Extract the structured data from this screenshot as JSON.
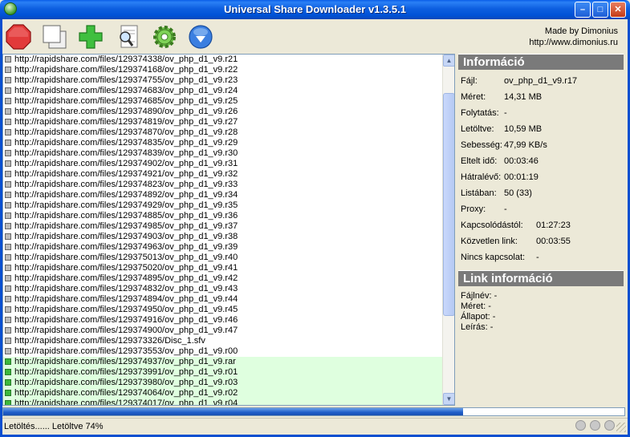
{
  "window": {
    "title": "Universal Share Downloader v1.3.5.1",
    "min_glyph": "–",
    "max_glyph": "□",
    "close_glyph": "✕"
  },
  "toolbar": {
    "icons": [
      "stop-icon",
      "copy-icon",
      "add-icon",
      "search-icon",
      "settings-icon",
      "info-icon"
    ],
    "madeby_line1": "Made by Dimonius",
    "madeby_line2": "http://www.dimonius.ru"
  },
  "list": {
    "rows": [
      {
        "url": "http://rapidshare.com/files/129374338/ov_php_d1_v9.r21",
        "done": false
      },
      {
        "url": "http://rapidshare.com/files/129374168/ov_php_d1_v9.r22",
        "done": false
      },
      {
        "url": "http://rapidshare.com/files/129374755/ov_php_d1_v9.r23",
        "done": false
      },
      {
        "url": "http://rapidshare.com/files/129374683/ov_php_d1_v9.r24",
        "done": false
      },
      {
        "url": "http://rapidshare.com/files/129374685/ov_php_d1_v9.r25",
        "done": false
      },
      {
        "url": "http://rapidshare.com/files/129374890/ov_php_d1_v9.r26",
        "done": false
      },
      {
        "url": "http://rapidshare.com/files/129374819/ov_php_d1_v9.r27",
        "done": false
      },
      {
        "url": "http://rapidshare.com/files/129374870/ov_php_d1_v9.r28",
        "done": false
      },
      {
        "url": "http://rapidshare.com/files/129374835/ov_php_d1_v9.r29",
        "done": false
      },
      {
        "url": "http://rapidshare.com/files/129374839/ov_php_d1_v9.r30",
        "done": false
      },
      {
        "url": "http://rapidshare.com/files/129374902/ov_php_d1_v9.r31",
        "done": false
      },
      {
        "url": "http://rapidshare.com/files/129374921/ov_php_d1_v9.r32",
        "done": false
      },
      {
        "url": "http://rapidshare.com/files/129374823/ov_php_d1_v9.r33",
        "done": false
      },
      {
        "url": "http://rapidshare.com/files/129374892/ov_php_d1_v9.r34",
        "done": false
      },
      {
        "url": "http://rapidshare.com/files/129374929/ov_php_d1_v9.r35",
        "done": false
      },
      {
        "url": "http://rapidshare.com/files/129374885/ov_php_d1_v9.r36",
        "done": false
      },
      {
        "url": "http://rapidshare.com/files/129374985/ov_php_d1_v9.r37",
        "done": false
      },
      {
        "url": "http://rapidshare.com/files/129374903/ov_php_d1_v9.r38",
        "done": false
      },
      {
        "url": "http://rapidshare.com/files/129374963/ov_php_d1_v9.r39",
        "done": false
      },
      {
        "url": "http://rapidshare.com/files/129375013/ov_php_d1_v9.r40",
        "done": false
      },
      {
        "url": "http://rapidshare.com/files/129375020/ov_php_d1_v9.r41",
        "done": false
      },
      {
        "url": "http://rapidshare.com/files/129374895/ov_php_d1_v9.r42",
        "done": false
      },
      {
        "url": "http://rapidshare.com/files/129374832/ov_php_d1_v9.r43",
        "done": false
      },
      {
        "url": "http://rapidshare.com/files/129374894/ov_php_d1_v9.r44",
        "done": false
      },
      {
        "url": "http://rapidshare.com/files/129374950/ov_php_d1_v9.r45",
        "done": false
      },
      {
        "url": "http://rapidshare.com/files/129374916/ov_php_d1_v9.r46",
        "done": false
      },
      {
        "url": "http://rapidshare.com/files/129374900/ov_php_d1_v9.r47",
        "done": false
      },
      {
        "url": "http://rapidshare.com/files/129373326/Disc_1.sfv",
        "done": false
      },
      {
        "url": "http://rapidshare.com/files/129373553/ov_php_d1_v9.r00",
        "done": false
      },
      {
        "url": "http://rapidshare.com/files/129374937/ov_php_d1_v9.rar",
        "done": true
      },
      {
        "url": "http://rapidshare.com/files/129373991/ov_php_d1_v9.r01",
        "done": true
      },
      {
        "url": "http://rapidshare.com/files/129373980/ov_php_d1_v9.r03",
        "done": true
      },
      {
        "url": "http://rapidshare.com/files/129374064/ov_php_d1_v9.r02",
        "done": true
      },
      {
        "url": "http://rapidshare.com/files/129374017/ov_php_d1_v9.r04",
        "done": true
      }
    ]
  },
  "info": {
    "header": "Információ",
    "rows": [
      {
        "label": "Fájl:",
        "value": "ov_php_d1_v9.r17"
      },
      {
        "label": "Méret:",
        "value": "14,31 MB"
      },
      {
        "label": "Folytatás:",
        "value": "-"
      },
      {
        "label": "Letöltve:",
        "value": "10,59 MB"
      },
      {
        "label": "Sebesség:",
        "value": "47,99 KB/s"
      },
      {
        "label": "Eltelt idő:",
        "value": "00:03:46"
      },
      {
        "label": "Hátralévő:",
        "value": "00:01:19"
      },
      {
        "label": "Listában:",
        "value": "50 (33)"
      },
      {
        "label": "Proxy:",
        "value": "-"
      },
      {
        "label": "Kapcsolódástól:",
        "value": "01:27:23"
      },
      {
        "label": "Közvetlen link:",
        "value": "00:03:55"
      },
      {
        "label": "Nincs kapcsolat:",
        "value": "-"
      }
    ]
  },
  "link_info": {
    "header": "Link információ",
    "rows": [
      {
        "label": "Fájlnév:",
        "value": "-"
      },
      {
        "label": "Méret:",
        "value": "-"
      },
      {
        "label": "Állapot:",
        "value": "-"
      },
      {
        "label": "Leírás:",
        "value": "-"
      }
    ]
  },
  "progress": {
    "percent": 74
  },
  "status": {
    "text": "Letöltés...... Letöltve 74%"
  },
  "colors": {
    "selection": "#dfffdf",
    "header": "#7a7a7a",
    "titlebar": "#0a5ee8"
  }
}
